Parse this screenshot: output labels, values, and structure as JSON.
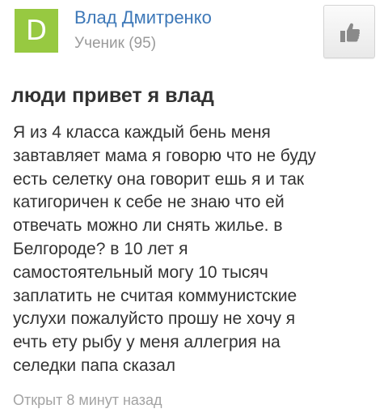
{
  "author": {
    "avatar_letter": "D",
    "avatar_color": "#97c941",
    "name": "Влад Дмитренко",
    "rank": "Ученик (95)",
    "name_color": "#3d78b8"
  },
  "like_button": {
    "icon": "thumbs-up-icon"
  },
  "question": {
    "title": "люди привет я влад",
    "body_lines": [
      "Я из 4 класса каждый бень меня",
      "завтавляет мама я говорю что не буду",
      "есть селетку она говорит ешь я и так",
      "катигоричен к себе не знаю что ей",
      "отвечать можно ли снять жилье. в",
      "Белгороде? в 10 лет я",
      "самостоятельный могу 10 тысяч",
      "заплатить не считая коммунистские",
      "услухи пожалуйсто прошу не хочу я",
      "ечть ету рыбу у меня аллегрия на",
      "селедки папа сказал"
    ],
    "opened": "Открыт 8 минут назад"
  }
}
